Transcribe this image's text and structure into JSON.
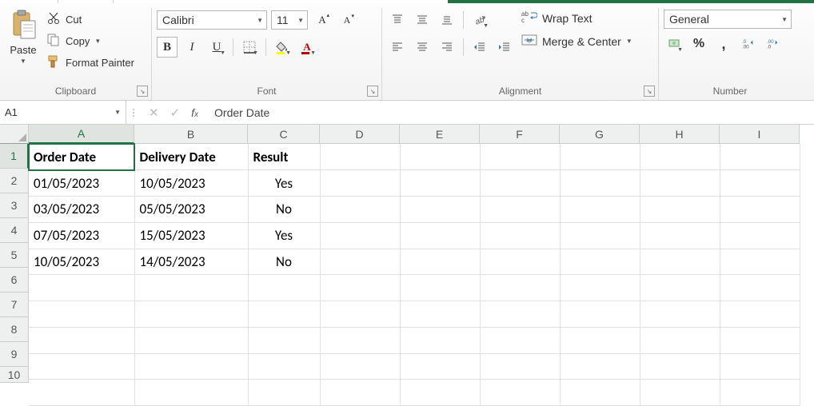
{
  "ribbon": {
    "clipboard": {
      "paste": "Paste",
      "cut": "Cut",
      "copy": "Copy",
      "format_painter": "Format Painter",
      "label": "Clipboard"
    },
    "font": {
      "name": "Calibri",
      "size": "11",
      "label": "Font"
    },
    "alignment": {
      "wrap": "Wrap Text",
      "merge": "Merge & Center",
      "label": "Alignment"
    },
    "number": {
      "format": "General",
      "percent": "%",
      "comma": ",",
      "label": "Number"
    }
  },
  "namebox": "A1",
  "formula": "Order Date",
  "columns": [
    "A",
    "B",
    "C",
    "D",
    "E",
    "F",
    "G",
    "H",
    "I"
  ],
  "rows": [
    "1",
    "2",
    "3",
    "4",
    "5",
    "6",
    "7",
    "8",
    "9",
    "10"
  ],
  "sheet": {
    "headers": {
      "a": "Order Date",
      "b": "Delivery Date",
      "c": "Result"
    },
    "r2": {
      "a": "01/05/2023",
      "b": "10/05/2023",
      "c": "Yes"
    },
    "r3": {
      "a": "03/05/2023",
      "b": "05/05/2023",
      "c": "No"
    },
    "r4": {
      "a": "07/05/2023",
      "b": "15/05/2023",
      "c": "Yes"
    },
    "r5": {
      "a": "10/05/2023",
      "b": "14/05/2023",
      "c": "No"
    }
  }
}
